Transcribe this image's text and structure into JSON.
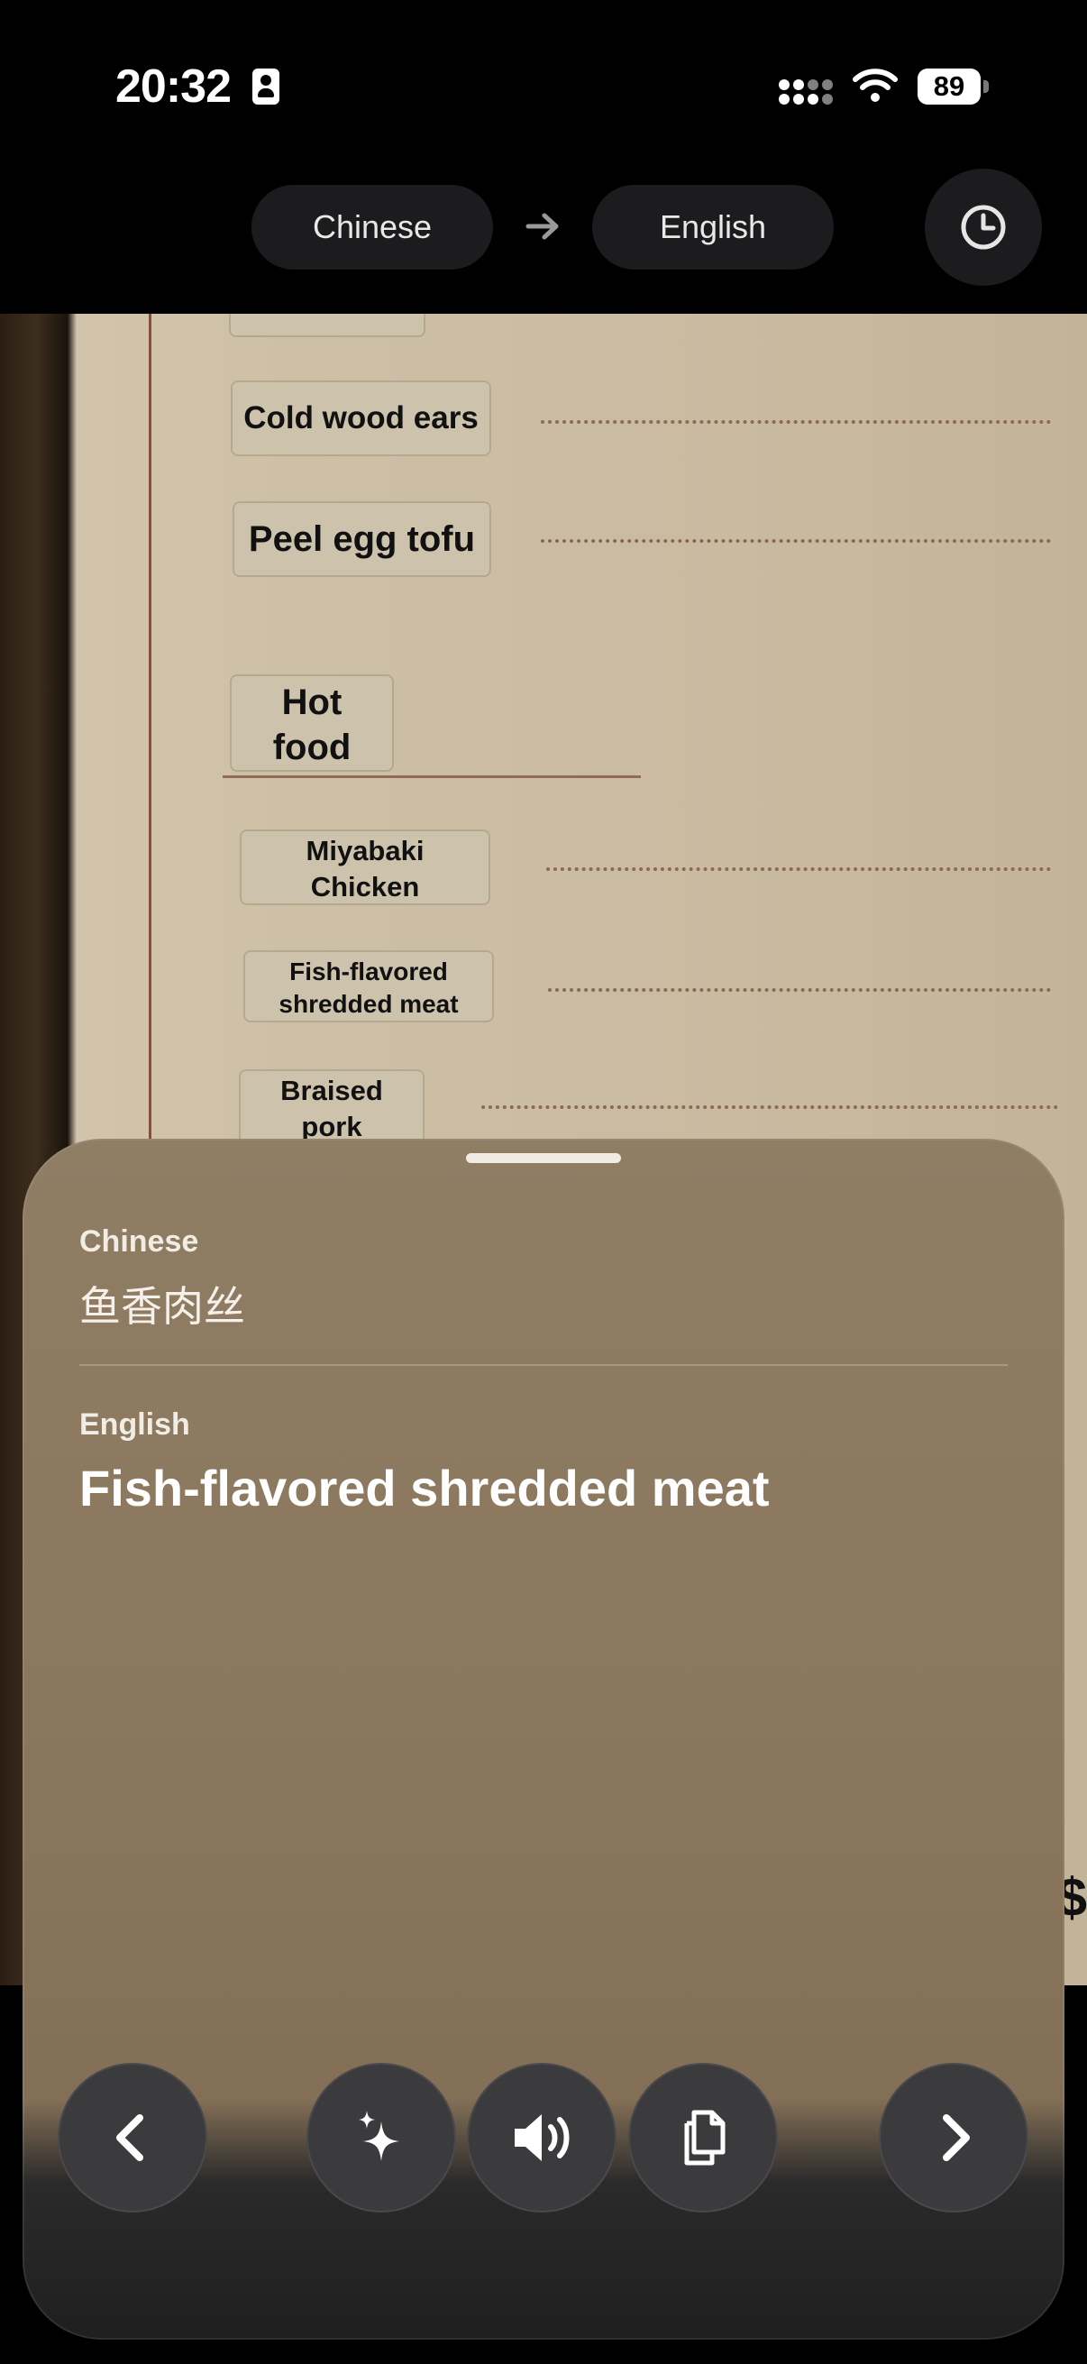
{
  "status_bar": {
    "time": "20:32",
    "battery": "89"
  },
  "languages": {
    "source": "Chinese",
    "target": "English"
  },
  "menu": {
    "items": [
      {
        "label": "Cold wood ears"
      },
      {
        "label": "Peel egg tofu"
      },
      {
        "label_line1": "Hot",
        "label_line2": "food"
      },
      {
        "label_line1": "Miyabaki",
        "label_line2": "Chicken"
      },
      {
        "label_line1": "Fish-flavored",
        "label_line2": "shredded meat"
      },
      {
        "label_line1": "Braised",
        "label_line2": "pork"
      }
    ],
    "edge_text": "$"
  },
  "sheet": {
    "source_label": "Chinese",
    "source_text": "鱼香肉丝",
    "target_label": "English",
    "target_text": "Fish-flavored shredded meat"
  },
  "icons": [
    "id-card-icon",
    "signal-icon",
    "wifi-icon",
    "battery-icon",
    "arrow-right-icon",
    "history-clock-icon",
    "chevron-left-icon",
    "sparkles-icon",
    "speaker-icon",
    "copy-icon",
    "chevron-right-icon"
  ]
}
